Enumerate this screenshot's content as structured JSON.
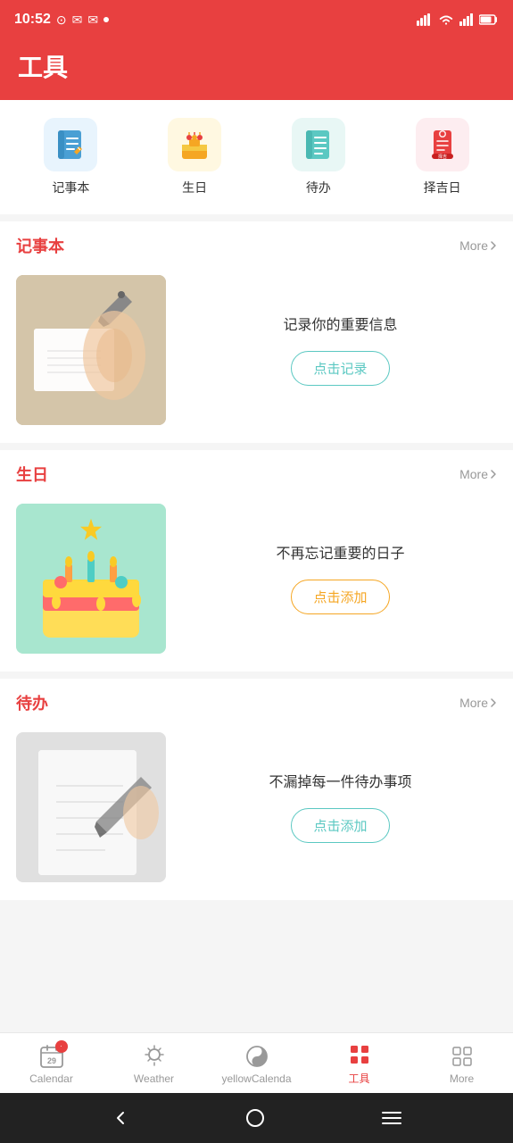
{
  "statusBar": {
    "time": "10:52",
    "leftIcons": [
      "⊙",
      "✉",
      "✉"
    ],
    "rightIcons": [
      "📶",
      "WiFi",
      "📡",
      "🔋"
    ]
  },
  "header": {
    "title": "工具"
  },
  "quickIcons": [
    {
      "id": "notebook",
      "label": "记事本",
      "color": "#e8f4fd",
      "icon": "📝",
      "iconColor": "#4a9fd4"
    },
    {
      "id": "birthday",
      "label": "生日",
      "color": "#fff8e1",
      "icon": "🎂",
      "iconColor": "#f5a623"
    },
    {
      "id": "todo",
      "label": "待办",
      "color": "#e8f7f5",
      "icon": "📋",
      "iconColor": "#5bc8c2"
    },
    {
      "id": "auspicious",
      "label": "择吉日",
      "color": "#fdedf0",
      "icon": "🎏",
      "iconColor": "#e84040"
    }
  ],
  "sections": [
    {
      "id": "notebook-section",
      "title": "记事本",
      "more": "More",
      "desc": "记录你的重要信息",
      "btnLabel": "点击记录",
      "btnType": "cyan"
    },
    {
      "id": "birthday-section",
      "title": "生日",
      "more": "More",
      "desc": "不再忘记重要的日子",
      "btnLabel": "点击添加",
      "btnType": "yellow"
    },
    {
      "id": "todo-section",
      "title": "待办",
      "more": "More",
      "desc": "不漏掉每一件待办事项",
      "btnLabel": "点击添加",
      "btnType": "cyan"
    }
  ],
  "bottomNav": [
    {
      "id": "calendar",
      "label": "Calendar",
      "icon": "📅",
      "badge": "29",
      "active": false
    },
    {
      "id": "weather",
      "label": "Weather",
      "active": false
    },
    {
      "id": "yellowcalenda",
      "label": "yellowCalenda",
      "active": false
    },
    {
      "id": "tools",
      "label": "工具",
      "active": true
    },
    {
      "id": "more",
      "label": "More",
      "active": false
    }
  ],
  "homeBar": {
    "back": "‹",
    "home": "○",
    "menu": "≡"
  }
}
